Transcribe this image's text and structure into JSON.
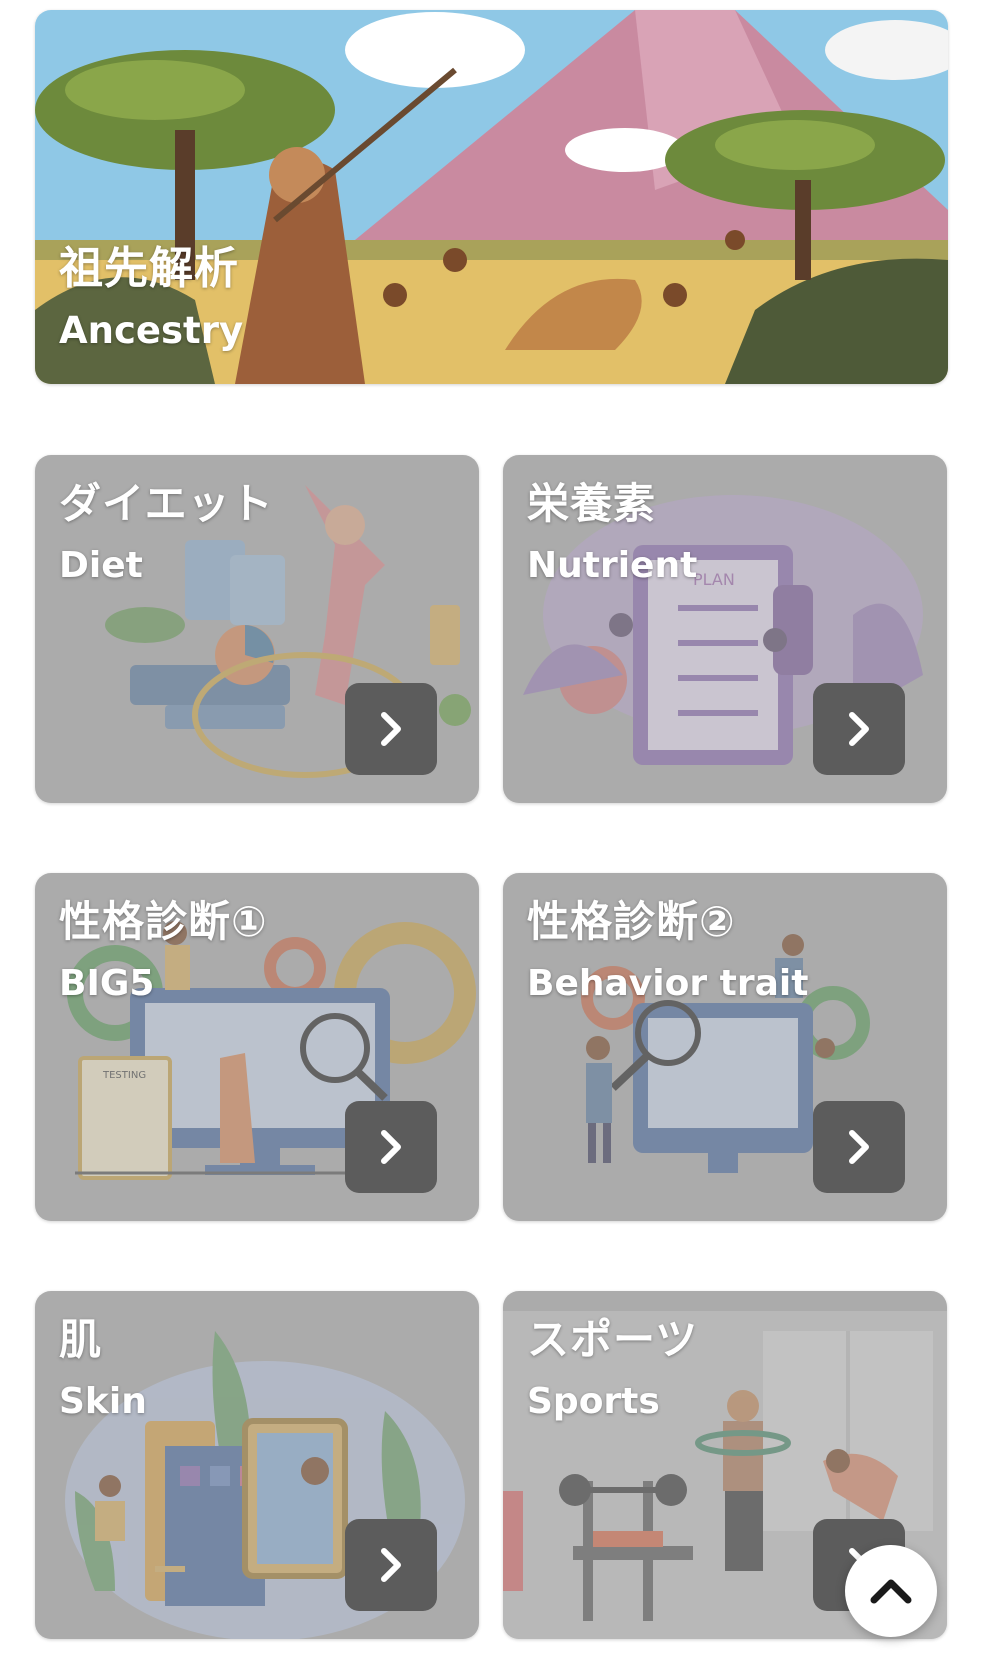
{
  "hero": {
    "title_jp": "祖先解析",
    "title_en": "Ancestry"
  },
  "tiles": [
    {
      "title_jp": "ダイエット",
      "title_en": "Diet"
    },
    {
      "title_jp": "栄養素",
      "title_en": "Nutrient",
      "art_text": "PLAN"
    },
    {
      "title_jp": "性格診断①",
      "title_en": "BIG5",
      "art_text": "TESTING"
    },
    {
      "title_jp": "性格診断②",
      "title_en": "Behavior trait"
    },
    {
      "title_jp": "肌",
      "title_en": "Skin"
    },
    {
      "title_jp": "スポーツ",
      "title_en": "Sports"
    }
  ],
  "icons": {
    "card_arrow": "chevron-right-icon",
    "scroll_top": "chevron-up-icon"
  },
  "colors": {
    "tile_overlay": "#ababab",
    "arrow_button": "#5c5c5c",
    "title_text": "#ffffff"
  }
}
